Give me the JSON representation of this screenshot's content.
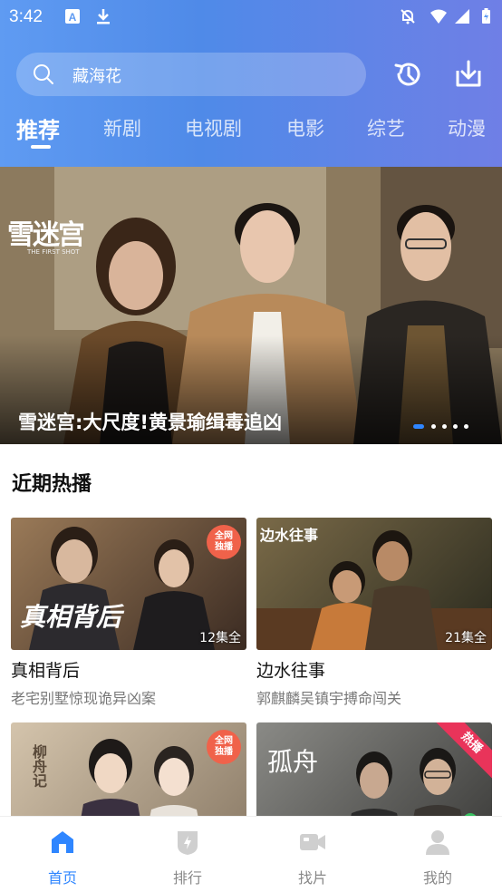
{
  "status_bar": {
    "time": "3:42"
  },
  "search": {
    "text": "藏海花"
  },
  "tabs": [
    {
      "label": "推荐",
      "active": true
    },
    {
      "label": "新剧",
      "active": false
    },
    {
      "label": "电视剧",
      "active": false
    },
    {
      "label": "电影",
      "active": false
    },
    {
      "label": "综艺",
      "active": false
    },
    {
      "label": "动漫",
      "active": false
    }
  ],
  "banner": {
    "caption": "雪迷宫:大尺度!黄景瑜缉毒追凶",
    "logo": "雪迷宫",
    "logo_sub": "THE FIRST SHOT",
    "page_count": 5,
    "active_page": 1
  },
  "section": {
    "title": "近期热播"
  },
  "cards": [
    {
      "title": "真相背后",
      "subtitle": "老宅别墅惊现诡异凶案",
      "count": "12集全",
      "poster_word": "真相背后",
      "badge": "全网\n独播",
      "colors": [
        "#8a6a4a",
        "#3b2b22"
      ]
    },
    {
      "title": "边水往事",
      "subtitle": "郭麒麟吴镇宇搏命闯关",
      "count": "21集全",
      "poster_word": "边水往事",
      "colors": [
        "#6a5a3a",
        "#2a2a1e"
      ]
    },
    {
      "title": "",
      "subtitle": "",
      "poster_word": "柳舟记",
      "badge": "全网\n独播",
      "colors": [
        "#c7b7a0",
        "#6b5a4a"
      ]
    },
    {
      "title": "",
      "subtitle": "",
      "poster_word": "孤舟",
      "ribbon": "热播",
      "colors": [
        "#7a7a78",
        "#3a3a38"
      ]
    }
  ],
  "bottom_nav": [
    {
      "label": "首页",
      "icon": "home-icon",
      "active": true
    },
    {
      "label": "排行",
      "icon": "ranking-icon",
      "active": false
    },
    {
      "label": "找片",
      "icon": "video-camera-icon",
      "active": false
    },
    {
      "label": "我的",
      "icon": "user-icon",
      "active": false
    }
  ],
  "colors": {
    "accent": "#2f86ff",
    "header_start": "#5f9bf2",
    "header_end": "#6f7fe6"
  }
}
